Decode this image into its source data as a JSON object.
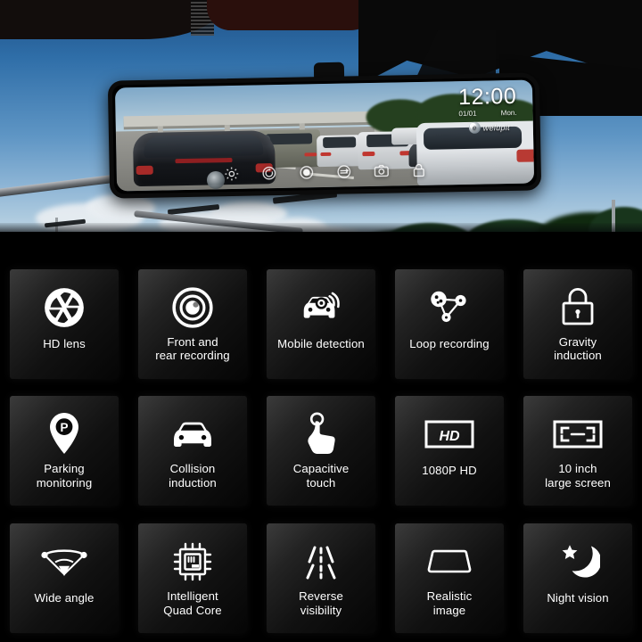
{
  "hero": {
    "name": "dashcam-rearview-mirror-product-photo",
    "mirror_display": {
      "clock_time": "12:00",
      "clock_date": "01/01",
      "clock_day": "Mon.",
      "brand_logo_text": "welupit",
      "toolbar_icons": [
        {
          "name": "settings-gear-icon",
          "label": "Settings"
        },
        {
          "name": "rotate-refresh-icon",
          "label": "Rotate"
        },
        {
          "name": "record-circle-icon",
          "label": "Record"
        },
        {
          "name": "swap-view-icon",
          "label": "Swap view"
        },
        {
          "name": "camera-snapshot-icon",
          "label": "Snapshot"
        },
        {
          "name": "lock-icon",
          "label": "Lock file"
        }
      ]
    }
  },
  "features": {
    "rows": [
      [
        {
          "icon": "aperture-icon",
          "label": "HD lens",
          "lines": [
            "HD lens"
          ]
        },
        {
          "icon": "dual-record-lens-icon",
          "label": "Front and rear recording",
          "lines": [
            "Front and",
            "rear recording"
          ]
        },
        {
          "icon": "car-motion-detect-icon",
          "label": "Mobile detection",
          "lines": [
            "Mobile detection"
          ]
        },
        {
          "icon": "loop-belt-icon",
          "label": "Loop recording",
          "lines": [
            "Loop recording"
          ]
        },
        {
          "icon": "lock-icon",
          "label": "Gravity induction",
          "lines": [
            "Gravity",
            "induction"
          ]
        }
      ],
      [
        {
          "icon": "parking-pin-icon",
          "label": "Parking monitoring",
          "lines": [
            "Parking",
            "monitoring"
          ]
        },
        {
          "icon": "car-front-icon",
          "label": "Collision induction",
          "lines": [
            "Collision",
            "induction"
          ]
        },
        {
          "icon": "touch-hand-icon",
          "label": "Capacitive touch",
          "lines": [
            "Capacitive",
            "touch"
          ]
        },
        {
          "icon": "hd-badge-icon",
          "label": "1080P HD",
          "lines": [
            "1080P HD"
          ]
        },
        {
          "icon": "fullscreen-frame-icon",
          "label": "10 inch large screen",
          "lines": [
            "10 inch",
            "large screen"
          ]
        }
      ],
      [
        {
          "icon": "wide-angle-fan-icon",
          "label": "Wide angle",
          "lines": [
            "Wide angle"
          ]
        },
        {
          "icon": "cpu-chip-icon",
          "label": "Intelligent Quad Core",
          "lines": [
            "Intelligent",
            "Quad Core"
          ]
        },
        {
          "icon": "road-lanes-icon",
          "label": "Reverse visibility",
          "lines": [
            "Reverse",
            "visibility"
          ]
        },
        {
          "icon": "mirror-shape-icon",
          "label": "Realistic image",
          "lines": [
            "Realistic",
            "image"
          ]
        },
        {
          "icon": "moon-star-icon",
          "label": "Night vision",
          "lines": [
            "Night vision"
          ]
        }
      ]
    ]
  },
  "colors": {
    "background": "#000000",
    "tile_light": "#3b3b3b",
    "tile_dark": "#050505",
    "text": "#ffffff",
    "sky_top": "#1d4f85",
    "sky_bottom": "#cfe0ea"
  }
}
